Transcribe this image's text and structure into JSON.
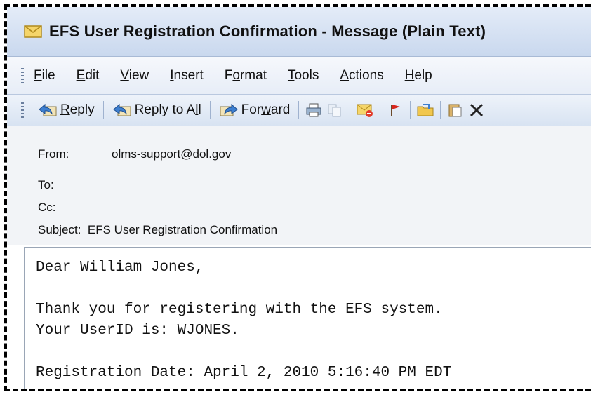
{
  "window": {
    "title": "EFS User Registration Confirmation - Message (Plain Text)"
  },
  "menu": [
    {
      "pre": "",
      "u": "F",
      "post": "ile"
    },
    {
      "pre": "",
      "u": "E",
      "post": "dit"
    },
    {
      "pre": "",
      "u": "V",
      "post": "iew"
    },
    {
      "pre": "",
      "u": "I",
      "post": "nsert"
    },
    {
      "pre": "F",
      "u": "o",
      "post": "rmat"
    },
    {
      "pre": "",
      "u": "T",
      "post": "ools"
    },
    {
      "pre": "",
      "u": "A",
      "post": "ctions"
    },
    {
      "pre": "",
      "u": "H",
      "post": "elp"
    }
  ],
  "toolbar": {
    "reply": {
      "pre": "",
      "u": "R",
      "post": "eply"
    },
    "reply_all": {
      "pre": "Reply to A",
      "u": "l",
      "post": "l"
    },
    "forward": {
      "pre": "For",
      "u": "w",
      "post": "ard"
    }
  },
  "header": {
    "from_label": "From:",
    "from_value": "olms-support@dol.gov",
    "to_label": "To:",
    "to_value": "",
    "cc_label": "Cc:",
    "cc_value": "",
    "subject_label": "Subject:",
    "subject_value": "EFS User Registration Confirmation"
  },
  "body": {
    "line1": "Dear William Jones,",
    "line2": "",
    "line3": "Thank you for registering with the EFS system.",
    "line4": "Your UserID is: WJONES.",
    "line5": "",
    "line6": "Registration Date: April 2, 2010 5:16:40 PM EDT"
  }
}
